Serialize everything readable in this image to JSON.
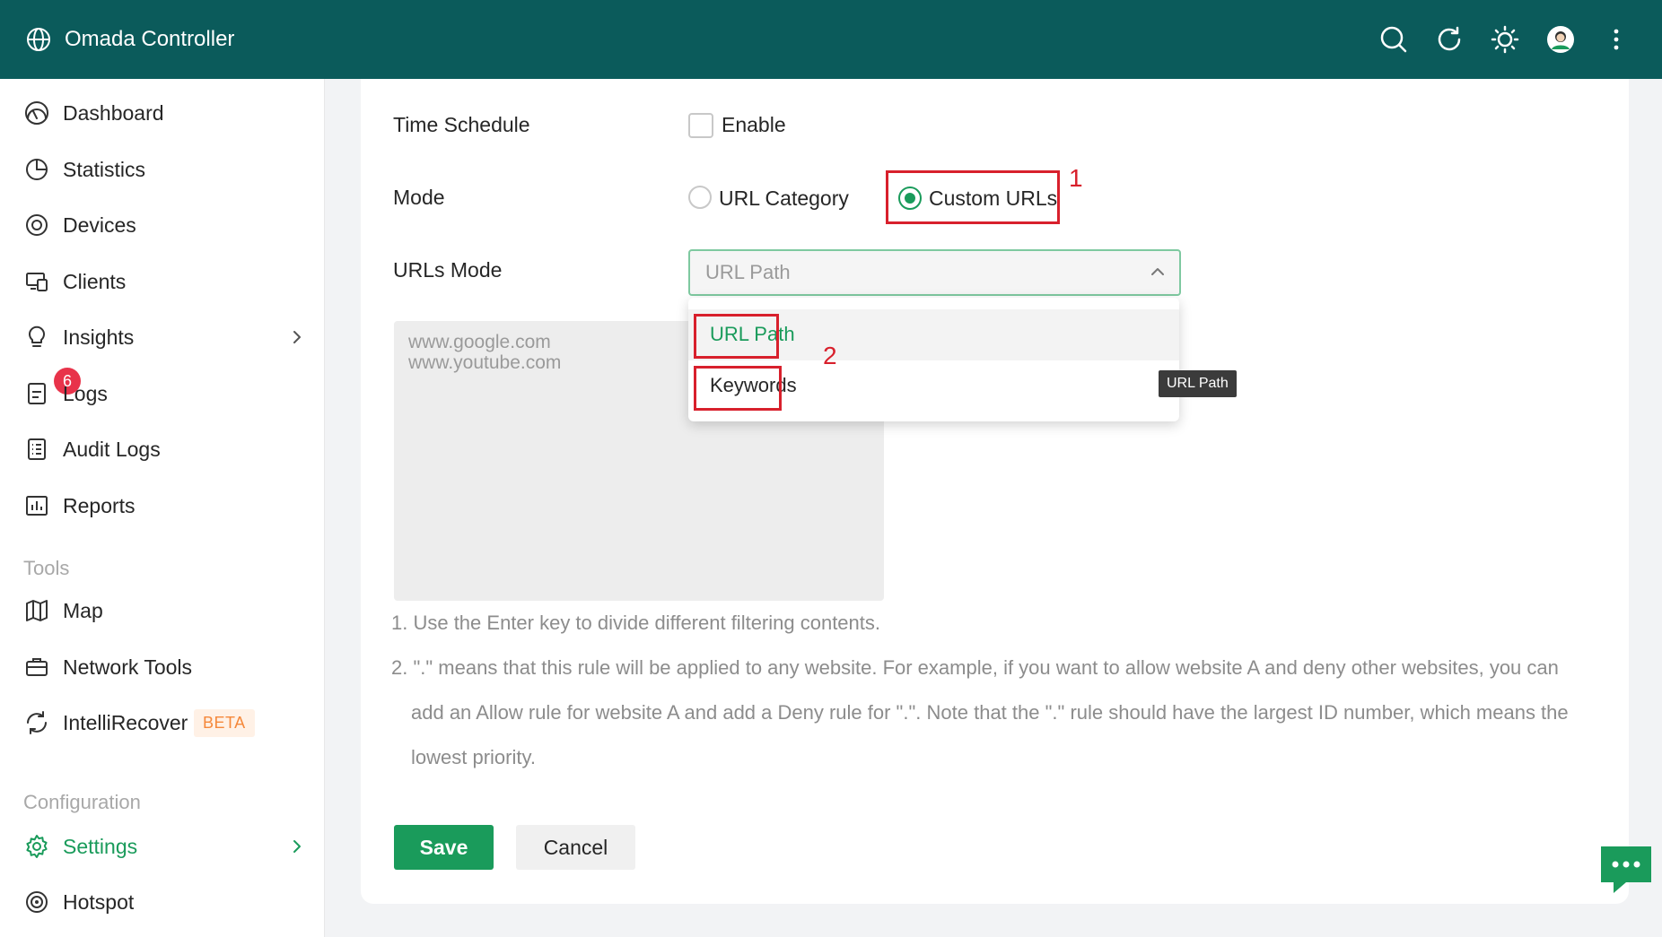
{
  "app": {
    "title": "Omada Controller"
  },
  "header": {
    "icons": [
      "search-icon",
      "refresh-icon",
      "theme-sun-icon",
      "avatar-icon",
      "more-vertical-icon"
    ]
  },
  "sidebar": {
    "items": [
      {
        "label": "Dashboard",
        "icon": "dashboard-gauge-icon"
      },
      {
        "label": "Statistics",
        "icon": "pie-chart-icon"
      },
      {
        "label": "Devices",
        "icon": "devices-target-icon"
      },
      {
        "label": "Clients",
        "icon": "clients-screens-icon"
      },
      {
        "label": "Insights",
        "icon": "lightbulb-icon"
      },
      {
        "label": "Logs",
        "icon": "logs-doc-icon",
        "badge": "6"
      },
      {
        "label": "Audit Logs",
        "icon": "list-doc-icon"
      },
      {
        "label": "Reports",
        "icon": "bar-report-icon"
      }
    ],
    "tools_title": "Tools",
    "tools": [
      {
        "label": "Map",
        "icon": "map-icon"
      },
      {
        "label": "Network Tools",
        "icon": "toolbox-icon"
      },
      {
        "label": "IntelliRecover",
        "icon": "recover-cycle-icon",
        "tag": "BETA"
      }
    ],
    "config_title": "Configuration",
    "config": [
      {
        "label": "Settings",
        "icon": "gear-icon"
      },
      {
        "label": "Hotspot",
        "icon": "hotspot-icon"
      }
    ]
  },
  "form": {
    "time_schedule_label": "Time Schedule",
    "enable_label": "Enable",
    "mode_label": "Mode",
    "mode_option_category": "URL Category",
    "mode_option_custom": "Custom URLs",
    "urls_mode_label": "URLs Mode",
    "urls_mode_value": "URL Path",
    "urls_placeholder_line1": "www.google.com",
    "urls_placeholder_line2": "www.youtube.com",
    "dropdown_options": [
      "URL Path",
      "Keywords"
    ],
    "tooltip": "URL Path"
  },
  "notes": {
    "line1": "1. Use the Enter key to divide different filtering contents.",
    "line2a": "2. \".\" means that this rule will be applied to any website. For example, if you want to allow website A and deny other websites, you can",
    "line2b": "add an Allow rule for website A and add a Deny rule for \".\". Note that the \".\" rule should have the largest ID number, which means the",
    "line2c": "lowest priority."
  },
  "actions": {
    "save": "Save",
    "cancel": "Cancel"
  },
  "annotations": {
    "first": "1",
    "second": "2"
  },
  "colors": {
    "header": "#0b5b5b",
    "accent": "#1a9b5b",
    "annotation": "#d8202c"
  }
}
